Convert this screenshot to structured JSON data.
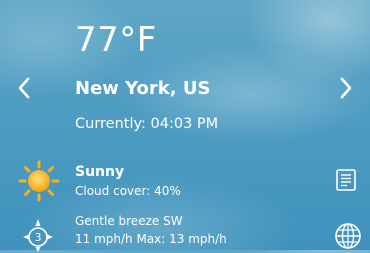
{
  "weather": {
    "temperature": "77°F",
    "location": "New York, US",
    "current_time": "Currently: 04:03 PM",
    "condition": "Sunny",
    "cloud_cover": "Cloud cover: 40%",
    "wind_description": "Gentle breeze SW",
    "wind_speed": "11 mph/h Max: 13 mph/h",
    "wind_force": "3"
  },
  "icons": {
    "prev": "chevron-left-icon",
    "next": "chevron-right-icon",
    "condition": "sun-icon",
    "wind": "compass-icon",
    "details": "document-icon",
    "map": "globe-icon"
  }
}
